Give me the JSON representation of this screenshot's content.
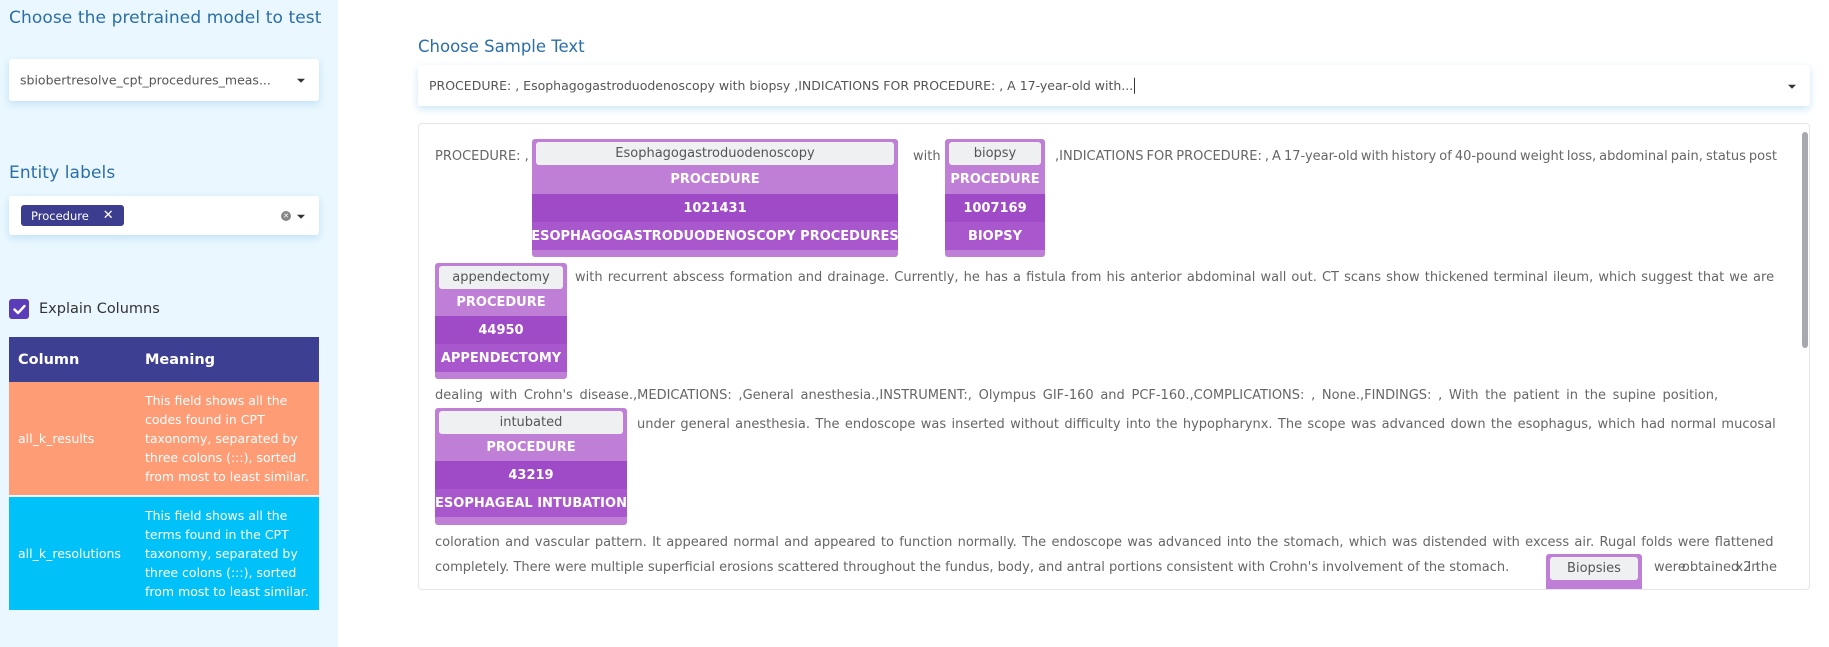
{
  "sidebar": {
    "model_title": "Choose the pretrained model to test",
    "model_value": "sbiobertresolve_cpt_procedures_meas...",
    "labels_title": "Entity labels",
    "labels_selected": [
      "Procedure"
    ],
    "explain_label": "Explain Columns",
    "explain_checked": true,
    "table": {
      "headers": [
        "Column",
        "Meaning"
      ],
      "rows": [
        {
          "column": "all_k_results",
          "meaning": "This field shows all the codes found in CPT taxonomy, separated by three colons (:::), sorted from most to least similar.",
          "color": "#fe9c76"
        },
        {
          "column": "all_k_resolutions",
          "meaning": "This field shows all the terms found in the CPT taxonomy, separated by three colons (:::), sorted from most to least similar.",
          "color": "#00c2f8"
        }
      ]
    }
  },
  "main": {
    "sample_title": "Choose Sample Text",
    "sample_value": "PROCEDURE: , Esophagogastroduodenoscopy with biopsy ,INDICATIONS FOR PROCEDURE: , A 17-year-old with...",
    "text": {
      "t0": "PROCEDURE: ,",
      "t1": "with",
      "t2": ",INDICATIONS FOR PROCEDURE: , A 17-year-old with history of 40-pound weight loss, abdominal pain, status post",
      "t3": "with recurrent abscess formation and drainage.  Currently, he has a fistula from his anterior abdominal wall out.   CT scans show thickened terminal ileum, which suggest that we are",
      "t4": "dealing  with  Crohn's  disease.,MEDICATIONS:    ,General  anesthesia.,INSTRUMENT:,    Olympus  GIF-160  and  PCF-160.,COMPLICATIONS:  ,  None.,FINDINGS:  ,  With  the  patient  in  the  supine  position,",
      "t5": "under general anesthesia. The endoscope was inserted without difficulty into the hypopharynx.  The scope was advanced down the esophagus, which had normal mucosal",
      "t6": "coloration and vascular pattern.  It appeared normal and appeared to function normally.  The endoscope was advanced into the stomach, which was distended with excess air.  Rugal folds were flattened",
      "t7": "completely.  There were multiple superficial erosions scattered throughout the fundus, body, and antral portions consistent with Crohn's involvement of the stomach.",
      "t8": "were obtained x2 in the"
    },
    "entities": [
      {
        "chunk": "Esophagogastroduodenoscopy",
        "label": "PROCEDURE",
        "code": "1021431",
        "resolution": "ESOPHAGOGASTRODUODENOSCOPY PROCEDURES"
      },
      {
        "chunk": "biopsy",
        "label": "PROCEDURE",
        "code": "1007169",
        "resolution": "BIOPSY"
      },
      {
        "chunk": "appendectomy",
        "label": "PROCEDURE",
        "code": "44950",
        "resolution": "APPENDECTOMY"
      },
      {
        "chunk": "intubated",
        "label": "PROCEDURE",
        "code": "43219",
        "resolution": "ESOPHAGEAL INTUBATION"
      },
      {
        "chunk": "Biopsies",
        "label": "PROCEDURE",
        "code": "",
        "resolution": ""
      }
    ]
  }
}
